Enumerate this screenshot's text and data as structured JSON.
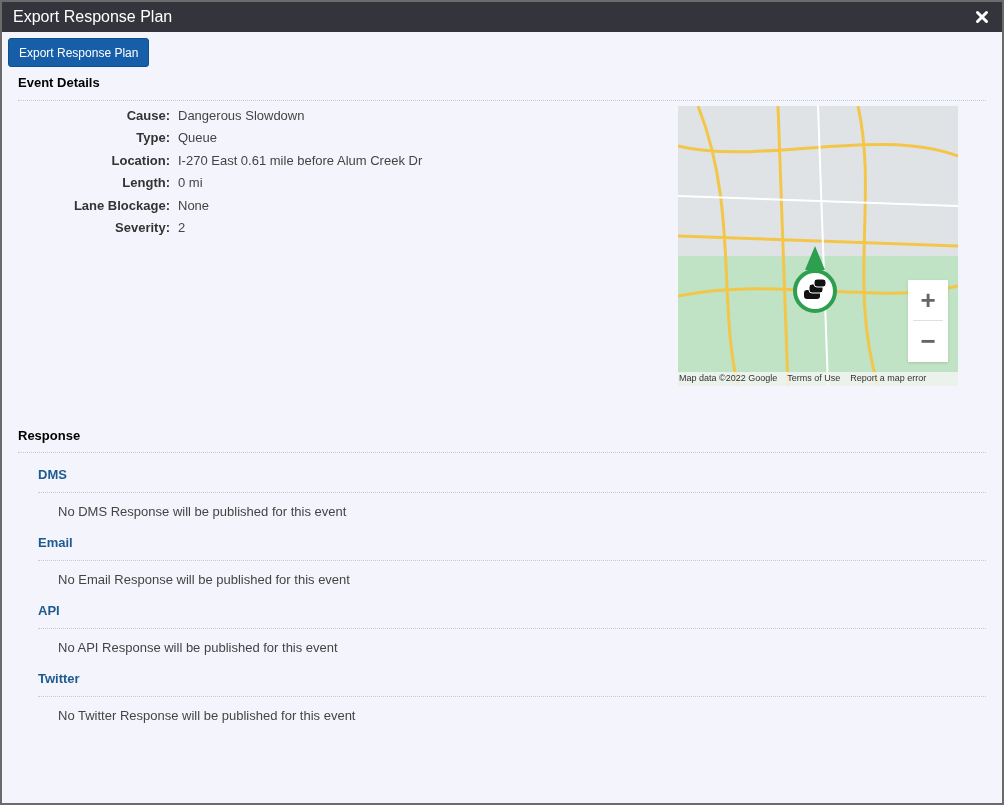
{
  "dialog": {
    "title": "Export Response Plan"
  },
  "export_button": "Export Response Plan",
  "event_details": {
    "heading": "Event Details",
    "fields": [
      {
        "label": "Cause:",
        "value": "Dangerous Slowdown"
      },
      {
        "label": "Type:",
        "value": "Queue"
      },
      {
        "label": "Location:",
        "value": "I-270 East 0.61 mile before Alum Creek Dr"
      },
      {
        "label": "Length:",
        "value": "0 mi"
      },
      {
        "label": "Lane Blockage:",
        "value": "None"
      },
      {
        "label": "Severity:",
        "value": "2"
      }
    ]
  },
  "map": {
    "zoom_in": "+",
    "zoom_out": "−",
    "attribution": [
      "Map data ©2022 Google",
      "Terms of Use",
      "Report a map error"
    ]
  },
  "response": {
    "heading": "Response",
    "sections": [
      {
        "title": "DMS",
        "message": "No DMS Response will be published for this event"
      },
      {
        "title": "Email",
        "message": "No Email Response will be published for this event"
      },
      {
        "title": "API",
        "message": "No API Response will be published for this event"
      },
      {
        "title": "Twitter",
        "message": "No Twitter Response will be published for this event"
      }
    ]
  }
}
